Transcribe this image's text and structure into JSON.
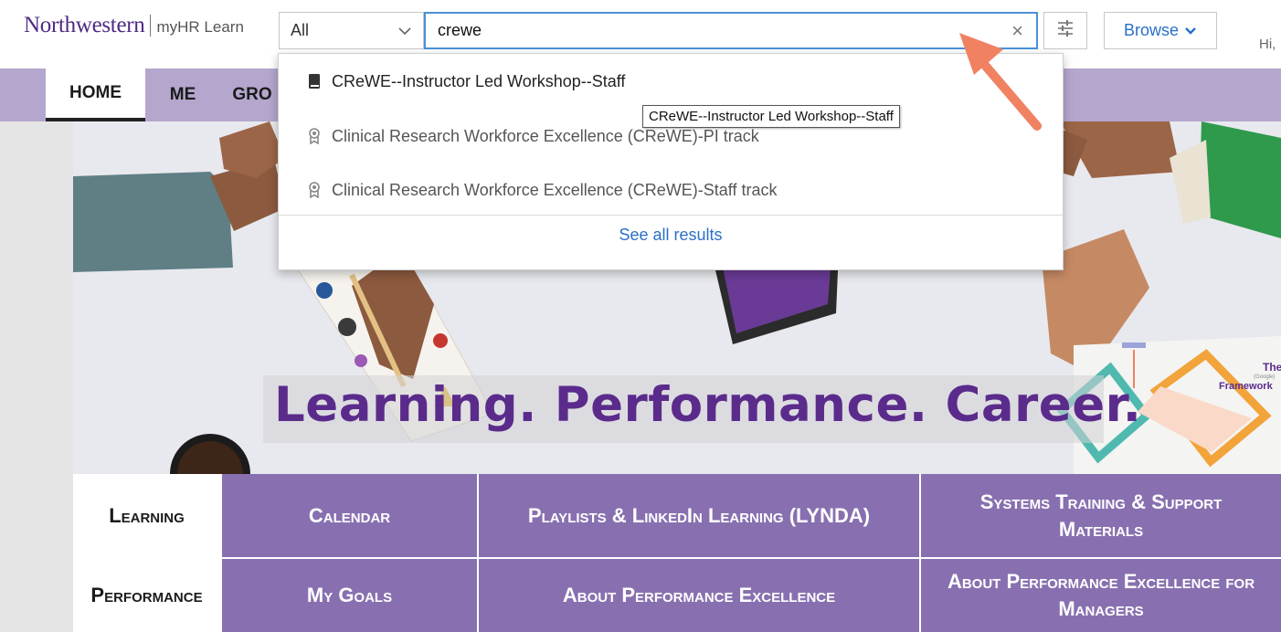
{
  "header": {
    "logo_primary": "Northwestern",
    "logo_secondary": "myHR Learn",
    "scope_select_value": "All",
    "search_value": "crewe",
    "clear_glyph": "×",
    "browse_label": "Browse",
    "greeting": "Hi,"
  },
  "nav": {
    "tabs": [
      {
        "label": "HOME",
        "active": true
      },
      {
        "label": "ME",
        "active": false
      },
      {
        "label": "GRO",
        "active": false
      }
    ]
  },
  "search_dropdown": {
    "items": [
      {
        "label": "CReWE--Instructor Led Workshop--Staff",
        "icon": "book-icon"
      },
      {
        "label": "Clinical Research Workforce Excellence (CReWE)-PI track",
        "icon": "certification-badge-icon"
      },
      {
        "label": "Clinical Research Workforce Excellence (CReWE)-Staff track",
        "icon": "certification-badge-icon"
      }
    ],
    "see_all": "See all results",
    "tooltip": "CReWE--Instructor Led Workshop--Staff"
  },
  "hero": {
    "tagline": "Learning. Performance. Career.",
    "framework_partial": "The",
    "framework_sub": "(Google)",
    "framework_word": "Framework"
  },
  "tiles": {
    "row1": [
      "Learning",
      "Calendar",
      "Playlists & LinkedIn Learning (LYNDA)",
      "Systems Training & Support Materials"
    ],
    "row2": [
      "Performance",
      "My Goals",
      "About Performance Excellence",
      "About Performance Excellence for Managers"
    ]
  },
  "colors": {
    "brand_purple": "#4e2a84",
    "nav_bar": "#b4a6cc",
    "tile_purple": "#8870b0",
    "link_blue": "#2a6fc9",
    "annotation_arrow": "#f08262"
  }
}
